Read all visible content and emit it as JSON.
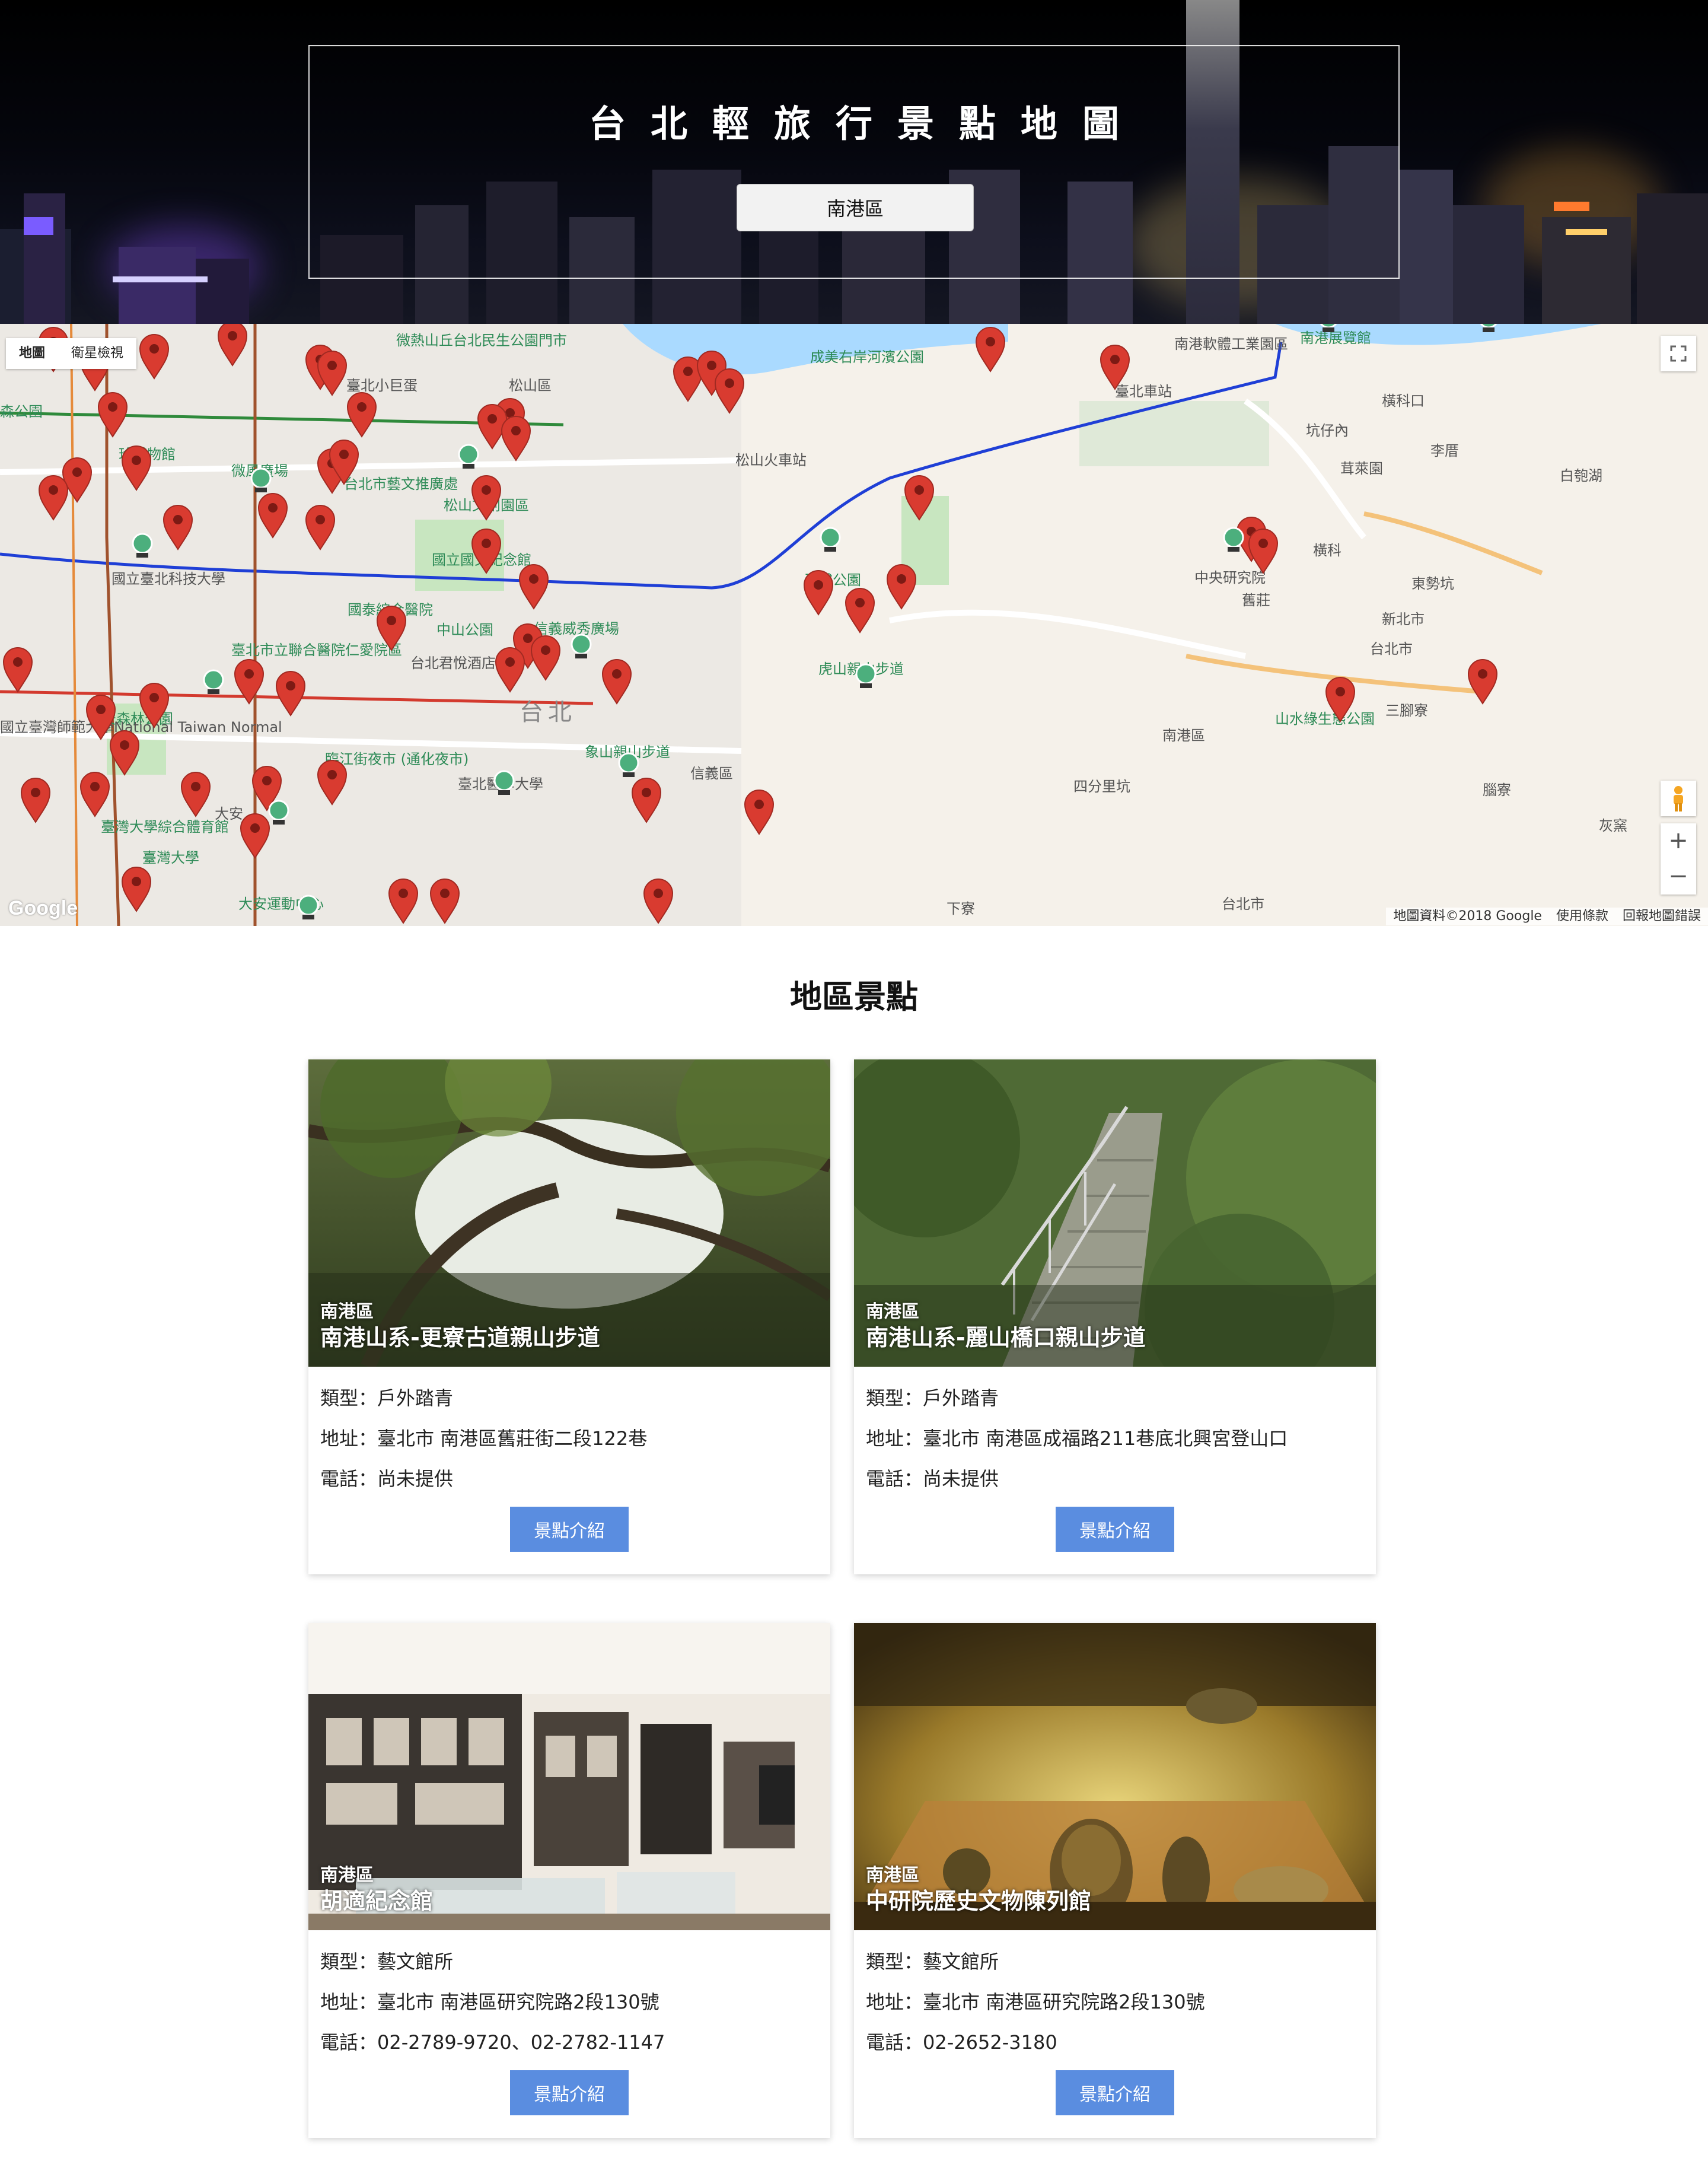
{
  "hero": {
    "title": "台北輕旅行景點地圖",
    "selected_district": "南港區"
  },
  "map": {
    "type_controls": [
      "地圖",
      "衛星檢視"
    ],
    "logo": "Google",
    "footer": [
      "地圖資料©2018 Google",
      "使用條款",
      "回報地圖錯誤"
    ],
    "labels": [
      "松山區",
      "成美右岸河濱公園",
      "南港軟體工業園區",
      "南港展覽館",
      "橫科口",
      "坑仔內",
      "李厝",
      "白匏湖",
      "茸萊園",
      "橫科",
      "東勢坑",
      "中央研究院",
      "舊莊",
      "新北市",
      "台北市",
      "三腳寮",
      "南港區",
      "山水綠生態公園",
      "四分里坑",
      "腦寮",
      "灰窯",
      "下寮",
      "台北市",
      "信義區",
      "象山親山步道",
      "虎山親山步道",
      "玉成公園",
      "松山火車站",
      "國立國父紀念館",
      "中山公園",
      "國泰綜合醫院",
      "信義威秀廣場",
      "台北君悅酒店",
      "台北",
      "臨江街夜市 (通化夜市)",
      "臺北醫學大學",
      "大安",
      "國立臺北科技大學",
      "大安森林公園",
      "臺灣大學綜合體育館",
      "大安運動中心",
      "微風廣場",
      "松山文創園區",
      "臺北市立聯合醫院仁愛院區",
      "台北市藝文推廣處",
      "臺北小巨蛋",
      "微熱山丘台北民生公園門市",
      "國立臺灣師範大學National Taiwan Normal",
      "臺灣大學",
      "珍博物館",
      "森公園",
      "臺北車站"
    ]
  },
  "section_title": "地區景點",
  "spots": [
    {
      "district": "南港區",
      "name": "南港山系-更寮古道親山步道",
      "type": "類型：戶外踏青",
      "address": "地址：臺北市 南港區舊莊街二段122巷",
      "phone": "電話：尚未提供",
      "button": "景點介紹"
    },
    {
      "district": "南港區",
      "name": "南港山系-麗山橋口親山步道",
      "type": "類型：戶外踏青",
      "address": "地址：臺北市 南港區成福路211巷底北興宮登山口",
      "phone": "電話：尚未提供",
      "button": "景點介紹"
    },
    {
      "district": "南港區",
      "name": "胡適紀念館",
      "type": "類型：藝文館所",
      "address": "地址：臺北市 南港區研究院路2段130號",
      "phone": "電話：02-2789-9720、02-2782-1147",
      "button": "景點介紹"
    },
    {
      "district": "南港區",
      "name": "中研院歷史文物陳列館",
      "type": "類型：藝文館所",
      "address": "地址：臺北市 南港區研究院路2段130號",
      "phone": "電話：02-2652-3180",
      "button": "景點介紹"
    }
  ],
  "colors": {
    "accent_button": "#5a8de0",
    "marker_red": "#d93b30",
    "marker_green": "#4caf7d",
    "mrt_blue": "#1f3fd6",
    "mrt_green": "#2f8a3b",
    "mrt_red": "#d33a2e",
    "mrt_brown": "#a0522d"
  }
}
